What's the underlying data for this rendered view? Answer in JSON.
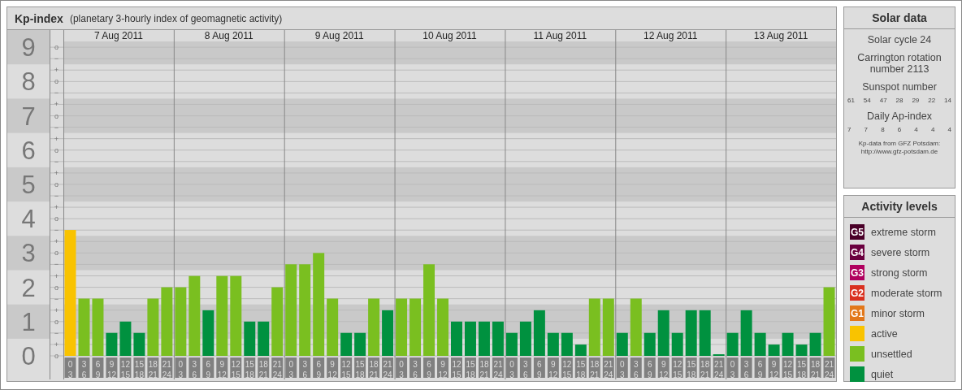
{
  "kp_panel": {
    "title": "Kp-index",
    "subtitle": "(planetary 3-hourly index of geomagnetic activity)",
    "days": [
      "7 Aug 2011",
      "8 Aug 2011",
      "9 Aug 2011",
      "10 Aug 2011",
      "11 Aug 2011",
      "12 Aug 2011",
      "13 Aug 2011"
    ],
    "scale_marks": [
      "o",
      "−",
      "+",
      "o",
      "−",
      "+",
      "o",
      "−",
      "+",
      "o",
      "−",
      "+",
      "o",
      "−",
      "+",
      "o",
      "−",
      "+",
      "o",
      "−",
      "+",
      "o",
      "−",
      "+",
      "o",
      "−",
      "+",
      "o"
    ],
    "chart_data": {
      "type": "bar",
      "grid": true,
      "ylim": [
        0,
        9.5
      ],
      "yticks": [
        0,
        1,
        2,
        3,
        4,
        5,
        6,
        7,
        8,
        9
      ],
      "categories": [
        "0 3",
        "3 6",
        "6 9",
        "9 12",
        "12 15",
        "15 18",
        "18 21",
        "21 24",
        "0 3",
        "3 6",
        "6 9",
        "9 12",
        "12 15",
        "15 18",
        "18 21",
        "21 24",
        "0 3",
        "3 6",
        "6 9",
        "9 12",
        "12 15",
        "15 18",
        "18 21",
        "21 24",
        "0 3",
        "3 6",
        "6 9",
        "9 12",
        "12 15",
        "15 18",
        "18 21",
        "21 24",
        "0 3",
        "3 6",
        "6 9",
        "9 12",
        "12 15",
        "15 18",
        "18 21",
        "21 24",
        "0 3",
        "3 6",
        "6 9",
        "9 12",
        "12 15",
        "15 18",
        "18 21",
        "21 24",
        "0 3",
        "3 6",
        "6 9",
        "9 12",
        "12 15",
        "15 18",
        "18 21",
        "21 24"
      ],
      "series": [
        {
          "name": "active",
          "color": "#f9c300",
          "values": [
            3.67,
            null,
            null,
            null,
            null,
            null,
            null,
            null,
            null,
            null,
            null,
            null,
            null,
            null,
            null,
            null,
            null,
            null,
            null,
            null,
            null,
            null,
            null,
            null,
            null,
            null,
            null,
            null,
            null,
            null,
            null,
            null,
            null,
            null,
            null,
            null,
            null,
            null,
            null,
            null,
            null,
            null,
            null,
            null,
            null,
            null,
            null,
            null,
            null,
            null,
            null,
            null,
            null,
            null,
            null,
            null
          ]
        },
        {
          "name": "unsettled",
          "color": "#7abf20",
          "values": [
            null,
            1.67,
            1.67,
            null,
            null,
            null,
            1.67,
            2,
            2,
            2.33,
            null,
            2.33,
            2.33,
            null,
            null,
            2,
            2.67,
            2.67,
            3,
            1.67,
            null,
            null,
            1.67,
            null,
            1.67,
            1.67,
            2.67,
            1.67,
            null,
            null,
            null,
            null,
            null,
            null,
            null,
            null,
            null,
            null,
            1.67,
            1.67,
            null,
            1.67,
            null,
            null,
            null,
            null,
            null,
            null,
            null,
            null,
            null,
            null,
            null,
            null,
            null,
            2
          ]
        },
        {
          "name": "quiet",
          "color": "#00913f",
          "values": [
            null,
            null,
            null,
            0.67,
            1,
            0.67,
            null,
            null,
            null,
            null,
            1.33,
            null,
            null,
            1,
            1,
            null,
            null,
            null,
            null,
            null,
            0.67,
            0.67,
            null,
            1.33,
            null,
            null,
            null,
            null,
            1,
            1,
            1,
            1,
            0.67,
            1,
            1.33,
            0.67,
            0.67,
            0.33,
            null,
            null,
            0.67,
            null,
            0.67,
            1.33,
            0.67,
            1.33,
            1.33,
            0,
            0.67,
            1.33,
            0.67,
            0.33,
            0.67,
            0.33,
            0.67,
            null
          ]
        }
      ]
    }
  },
  "solar_data": {
    "title": "Solar data",
    "cycle": "Solar cycle 24",
    "carrington": "Carrington rotation number 2113",
    "sunspot_label": "Sunspot number",
    "sunspot_numbers": [
      "61",
      "54",
      "47",
      "28",
      "29",
      "22",
      "14"
    ],
    "ap_label": "Daily Ap-index",
    "ap_values": [
      "7",
      "7",
      "8",
      "6",
      "4",
      "4",
      "4"
    ],
    "source": "Kp-data from GFZ Potsdam:",
    "source_url": "http://www.gfz-potsdam.de"
  },
  "activity_levels": {
    "title": "Activity levels",
    "items": [
      {
        "badge": "G5",
        "label": "extreme storm",
        "color": "#4a0028"
      },
      {
        "badge": "G4",
        "label": "severe storm",
        "color": "#6a003f"
      },
      {
        "badge": "G3",
        "label": "strong storm",
        "color": "#b0005e"
      },
      {
        "badge": "G2",
        "label": "moderate storm",
        "color": "#d9301f"
      },
      {
        "badge": "G1",
        "label": "minor storm",
        "color": "#e2771a"
      }
    ]
  }
}
